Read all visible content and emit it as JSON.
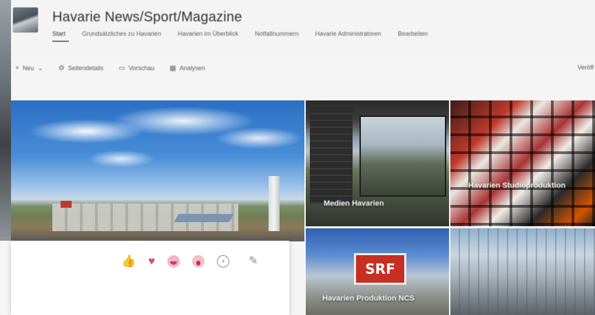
{
  "site": {
    "title": "Havarie News/Sport/Magazine",
    "nav": [
      "Start",
      "Grundsätzliches zu Havarien",
      "Havarien im Überblick",
      "Notfallnummern",
      "Havarie Administratoren",
      "Bearbeiten"
    ]
  },
  "command_bar": {
    "new_label": "Neu",
    "items": [
      "Seitendetails",
      "Vorschau",
      "Analysen"
    ],
    "right_label": "Veröff"
  },
  "hero": {
    "tiles": [
      {
        "label": "Medien Havarien"
      },
      {
        "label": "Havarien Studioproduktion"
      },
      {
        "label": "Havarien Produktion NCS"
      },
      {
        "label": ""
      }
    ],
    "sign_text": "SRF"
  },
  "reactions": {
    "items": [
      "like-icon",
      "heart-icon",
      "laugh-icon",
      "surprised-icon",
      "add-reaction-icon",
      "edit-icon"
    ]
  }
}
